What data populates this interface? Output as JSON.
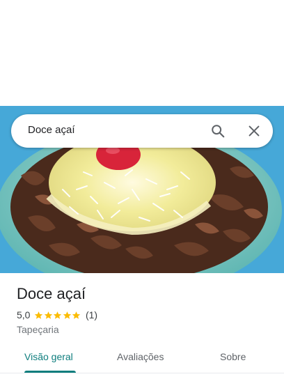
{
  "search": {
    "query": "Doce açaí"
  },
  "place": {
    "name": "Doce açaí",
    "rating": "5,0",
    "stars": 5,
    "review_count": "(1)",
    "category": "Tapeçaria"
  },
  "tabs": [
    {
      "label": "Visão geral",
      "active": true
    },
    {
      "label": "Avaliações",
      "active": false
    },
    {
      "label": "Sobre",
      "active": false
    }
  ],
  "colors": {
    "accent": "#0d7d7d",
    "star": "#fbbc04"
  },
  "icons": [
    "search-icon",
    "close-icon",
    "star-icon"
  ]
}
